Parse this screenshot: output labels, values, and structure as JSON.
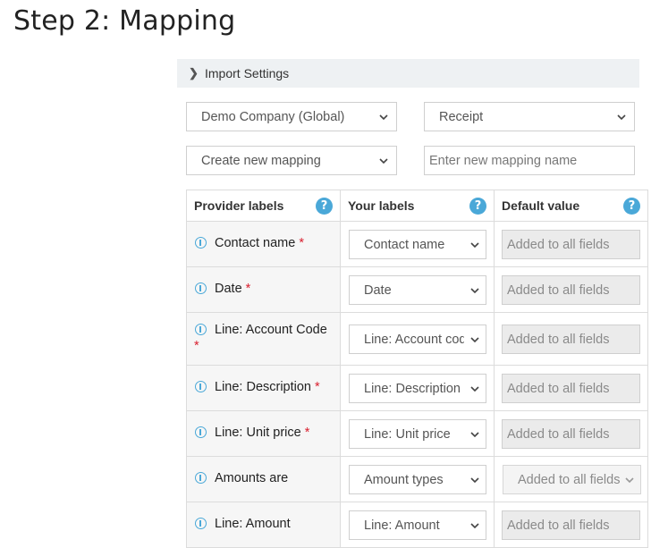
{
  "page": {
    "title": "Step 2: Mapping"
  },
  "import_settings": {
    "label": "Import Settings"
  },
  "selects": {
    "company": "Demo Company (Global)",
    "doc_type": "Receipt",
    "mapping": "Create new mapping",
    "mapping_name_placeholder": "Enter new mapping name"
  },
  "table": {
    "headers": {
      "provider": "Provider labels",
      "yours": "Your labels",
      "default": "Default value"
    },
    "rows": [
      {
        "label": "Contact name",
        "required": "*",
        "your": "Contact name",
        "default": "Added to all fields"
      },
      {
        "label": "Date",
        "required": "*",
        "your": "Date",
        "default": "Added to all fields"
      },
      {
        "label": "Line: Account Code",
        "required": "*",
        "your": "Line: Account code",
        "default": "Added to all fields"
      },
      {
        "label": "Line: Description",
        "required": "*",
        "your": "Line: Description",
        "default": "Added to all fields"
      },
      {
        "label": "Line: Unit price",
        "required": "*",
        "your": "Line: Unit price",
        "default": "Added to all fields"
      },
      {
        "label": "Amounts are",
        "required": "",
        "your": "Amount types",
        "default": "Added to all fields"
      },
      {
        "label": "Line: Amount",
        "required": "",
        "your": "Line: Amount",
        "default": "Added to all fields"
      }
    ]
  }
}
